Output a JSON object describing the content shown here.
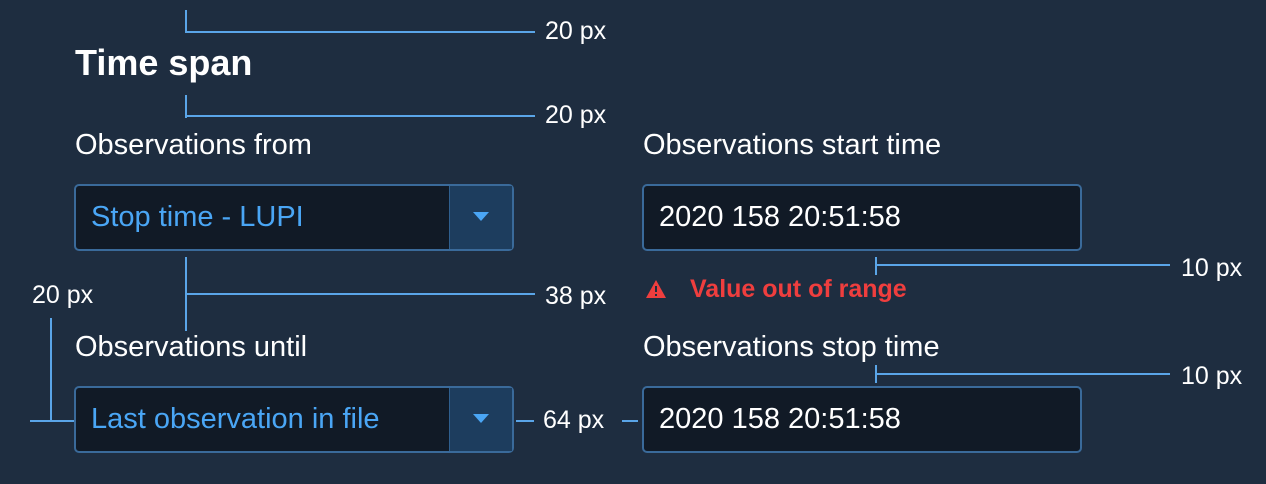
{
  "section": {
    "title": "Time span"
  },
  "from": {
    "label": "Observations from",
    "selected": "Stop time - LUPI"
  },
  "until": {
    "label": "Observations until",
    "selected": "Last observation in file"
  },
  "start_time": {
    "label": "Observations start time",
    "value": "2020 158 20:51:58",
    "error": "Value out of range"
  },
  "stop_time": {
    "label": "Observations stop time",
    "value": "2020 158 20:51:58"
  },
  "annotations": {
    "top_gap": "20 px",
    "title_gap": "20 px",
    "row_gap": "38 px",
    "left_pad": "20 px",
    "column_gap": "64 px",
    "error_gap": "10 px",
    "label_gap": "10 px"
  },
  "colors": {
    "background": "#1e2d40",
    "field_bg": "#111a26",
    "border": "#3a6a9a",
    "select_text": "#4aa6f5",
    "error": "#ef3e3e",
    "annotation": "#5aa5e8"
  }
}
